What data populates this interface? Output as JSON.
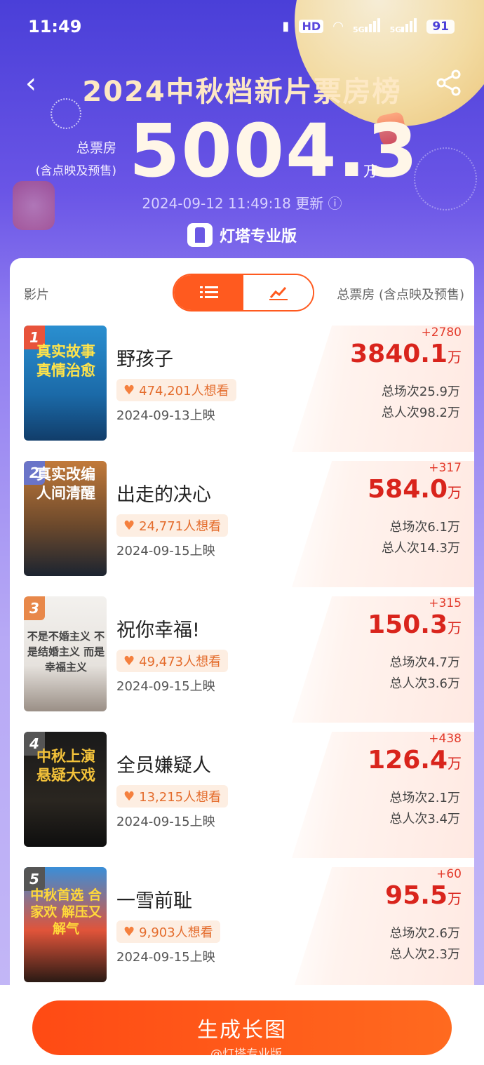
{
  "status_bar": {
    "time": "11:49",
    "network": "HD",
    "signal1": "5G",
    "signal2": "5G",
    "battery": "91"
  },
  "header": {
    "title": "2024中秋档新片票房榜",
    "total_label_line1": "总票房",
    "total_label_line2": "(含点映及预售)",
    "total_value": "5004.3",
    "total_unit": "万",
    "updated": "2024-09-12 11:49:18 更新 ⓘ",
    "brand": "灯塔专业版"
  },
  "table_head": {
    "film_col": "影片",
    "box_col": "总票房 (含点映及预售)"
  },
  "colors": {
    "accent": "#ff5a1f",
    "box_red": "#d9241c"
  },
  "movies": [
    {
      "rank": "1",
      "name": "野孩子",
      "want": "474,201人想看",
      "release": "2024-09-13上映",
      "delta": "+2780",
      "box": "3840.1",
      "unit": "万",
      "shows": "总场次25.9万",
      "people": "总人次98.2万",
      "poster_text": "真实故事 真情治愈"
    },
    {
      "rank": "2",
      "name": "出走的决心",
      "want": "24,771人想看",
      "release": "2024-09-15上映",
      "delta": "+317",
      "box": "584.0",
      "unit": "万",
      "shows": "总场次6.1万",
      "people": "总人次14.3万",
      "poster_text": "真实改编 人间清醒"
    },
    {
      "rank": "3",
      "name": "祝你幸福!",
      "want": "49,473人想看",
      "release": "2024-09-15上映",
      "delta": "+315",
      "box": "150.3",
      "unit": "万",
      "shows": "总场次4.7万",
      "people": "总人次3.6万",
      "poster_text": "不是不婚主义 不是结婚主义 而是幸福主义"
    },
    {
      "rank": "4",
      "name": "全员嫌疑人",
      "want": "13,215人想看",
      "release": "2024-09-15上映",
      "delta": "+438",
      "box": "126.4",
      "unit": "万",
      "shows": "总场次2.1万",
      "people": "总人次3.4万",
      "poster_text": "中秋上演 悬疑大戏"
    },
    {
      "rank": "5",
      "name": "一雪前耻",
      "want": "9,903人想看",
      "release": "2024-09-15上映",
      "delta": "+60",
      "box": "95.5",
      "unit": "万",
      "shows": "总场次2.6万",
      "people": "总人次2.3万",
      "poster_text": "中秋首选 合家欢 解压又解气"
    }
  ],
  "bottom": {
    "button": "生成长图",
    "watermark": "@灯塔专业版"
  }
}
